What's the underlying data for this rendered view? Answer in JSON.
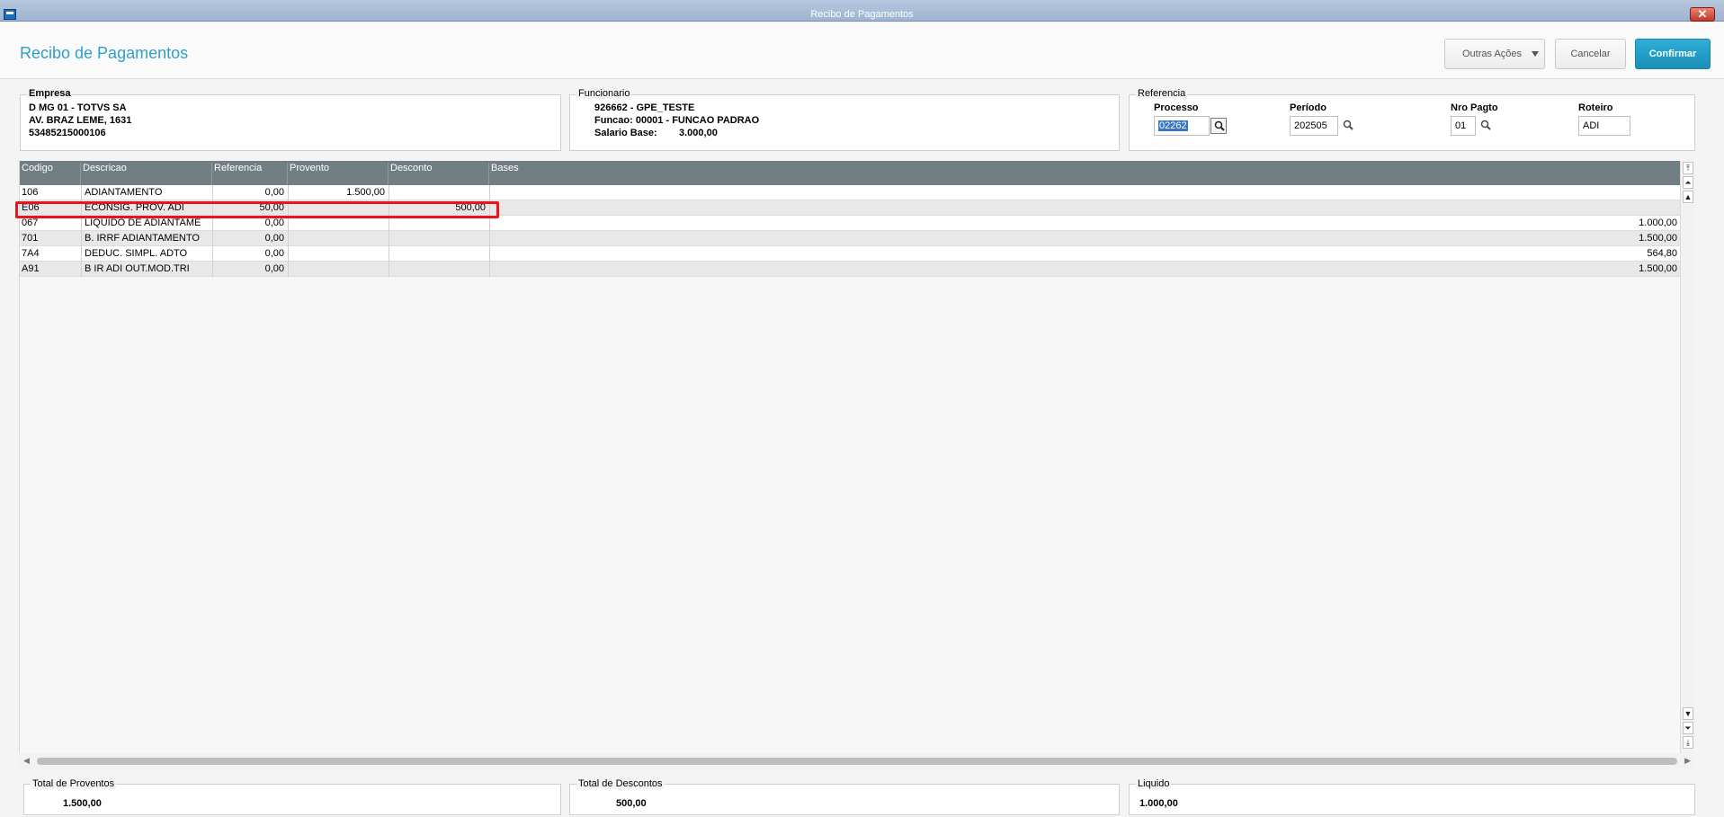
{
  "window": {
    "title": "Recibo de Pagamentos",
    "close_glyph": "✕"
  },
  "header": {
    "title": "Recibo de Pagamentos",
    "buttons": {
      "outras": "Outras Ações",
      "cancelar": "Cancelar",
      "confirmar": "Confirmar"
    }
  },
  "empresa": {
    "label": "Empresa",
    "line1": "D MG 01  - TOTVS SA",
    "line2": "AV. BRAZ LEME, 1631",
    "line3": "53485215000106"
  },
  "funcionario": {
    "label": "Funcionario",
    "line1": "926662 - GPE_TESTE",
    "line2": "Funcao: 00001 - FUNCAO PADRAO",
    "salario_label": "Salario Base:",
    "salario_value": "3.000,00"
  },
  "referencia": {
    "label": "Referencia",
    "processo": {
      "label": "Processo",
      "value": "02262"
    },
    "periodo": {
      "label": "Período",
      "value": "202505"
    },
    "nro_pagto": {
      "label": "Nro Pagto",
      "value": "01"
    },
    "roteiro": {
      "label": "Roteiro",
      "value": "ADI"
    }
  },
  "grid": {
    "columns": [
      "Codigo",
      "Descricao",
      "Referencia",
      "Provento",
      "Desconto",
      "Bases"
    ],
    "rows": [
      {
        "codigo": "106",
        "descricao": "ADIANTAMENTO",
        "referencia": "0,00",
        "provento": "1.500,00",
        "desconto": "",
        "bases": ""
      },
      {
        "codigo": "E06",
        "descricao": "ECONSIG. PROV. ADI",
        "referencia": "50,00",
        "provento": "",
        "desconto": "500,00",
        "bases": ""
      },
      {
        "codigo": "067",
        "descricao": "LIQUIDO DE ADIANTAME",
        "referencia": "0,00",
        "provento": "",
        "desconto": "",
        "bases": "1.000,00"
      },
      {
        "codigo": "701",
        "descricao": "B. IRRF ADIANTAMENTO",
        "referencia": "0,00",
        "provento": "",
        "desconto": "",
        "bases": "1.500,00"
      },
      {
        "codigo": "7A4",
        "descricao": "DEDUC. SIMPL. ADTO",
        "referencia": "0,00",
        "provento": "",
        "desconto": "",
        "bases": "564,80"
      },
      {
        "codigo": "A91",
        "descricao": "B IR ADI OUT.MOD.TRI",
        "referencia": "0,00",
        "provento": "",
        "desconto": "",
        "bases": "1.500,00"
      }
    ],
    "highlighted_row": 1
  },
  "totals": {
    "proventos": {
      "label": "Total de Proventos",
      "value": "1.500,00"
    },
    "descontos": {
      "label": "Total de Descontos",
      "value": "500,00"
    },
    "liquido": {
      "label": "Liquido",
      "value": "1.000,00"
    }
  },
  "colors": {
    "accent": "#2f9fc9",
    "confirm": "#1a8fb8",
    "grid_header": "#717f85",
    "highlight": "#e8141d"
  }
}
